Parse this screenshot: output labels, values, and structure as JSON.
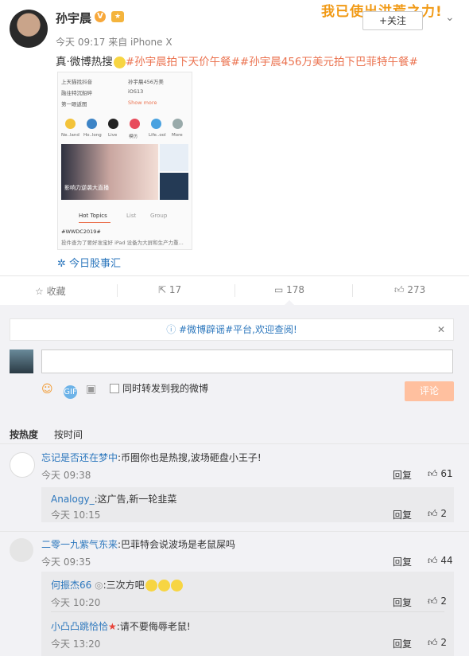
{
  "post": {
    "username": "孙宇晨",
    "verified_badge": "V",
    "timestamp": "今天 09:17 来自 iPhone X",
    "banner": "我已使出洪荒之力!",
    "follow_label": "+关注",
    "text_prefix": "真·微博热搜",
    "hashtag1": "#孙宇晨拍下天价午餐#",
    "hashtag2": "#孙宇晨456万美元拍下巴菲特午餐#",
    "attachment_label": "今日股事汇",
    "thumbnail": {
      "rows_left": [
        "上天猫找抖音",
        "融往特沉船碎",
        "第一眼返图"
      ],
      "rows_right": [
        "孙宇晨456万美",
        "iOS13",
        "Show more"
      ],
      "icons": [
        "Ne..land",
        "Ho..long",
        "Live",
        "模仿",
        "Life..ool",
        "More"
      ],
      "hero_caption": "影响力逆袭大直播",
      "tabs": [
        "Hot Topics",
        "List",
        "Group"
      ],
      "topic": "#WWDC2019#",
      "topic_desc": "投件查为了要好准宝好 iPad 设备为大屏和生产力重..."
    }
  },
  "actions": {
    "favorite_label": "收藏",
    "forward_count": "17",
    "comment_count": "178",
    "like_count": "273"
  },
  "composer": {
    "notice": "#微博辟谣#平台,欢迎查阅!",
    "forward_label": "同时转发到我的微博",
    "submit_label": "评论",
    "sort_hot": "按热度",
    "sort_time": "按时间"
  },
  "comments": [
    {
      "name": "忘记是否还在梦中",
      "text": ":币圈你也是热搜,波场砸盘小王子!",
      "time": "今天 09:38",
      "reply": "回复",
      "likes": "61",
      "replies": [
        {
          "name": "Analogy_",
          "text": ":这广告,新一轮韭菜",
          "time": "今天 10:15",
          "reply": "回复",
          "likes": "2"
        }
      ]
    },
    {
      "name": "二零一九紫气东来",
      "text": ":巴菲特会说波场是老鼠屎吗",
      "time": "今天 09:35",
      "reply": "回复",
      "likes": "44",
      "replies": [
        {
          "name": "何振杰66",
          "text": ":三次方吧",
          "time": "今天 10:20",
          "reply": "回复",
          "likes": "2"
        },
        {
          "name": "小凸凸跳恰恰",
          "text": ":请不要侮辱老鼠!",
          "time": "今天 13:20",
          "reply": "回复",
          "likes": "2"
        }
      ]
    }
  ]
}
